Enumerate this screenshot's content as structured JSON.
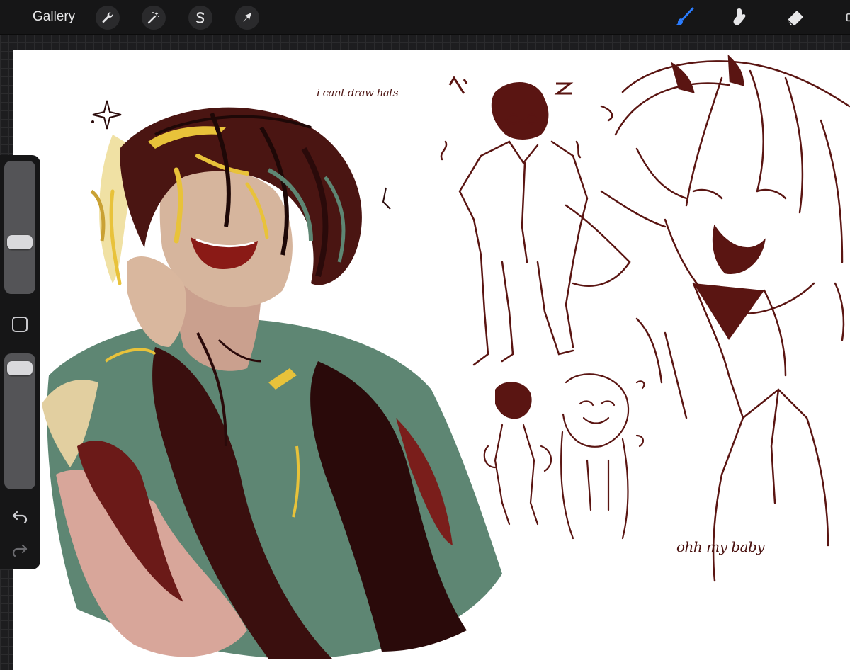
{
  "toolbar": {
    "gallery_label": "Gallery",
    "left_tools": [
      "wrench-icon",
      "magic-wand-icon",
      "selection-s-icon",
      "transform-arrow-icon"
    ],
    "right_tools": [
      "brush-icon",
      "smudge-icon",
      "eraser-icon"
    ],
    "active_tool": "brush-icon",
    "accent_color": "#2a7cff"
  },
  "canvas": {
    "annotations": {
      "hats_note": "i cant draw hats",
      "baby_note": "ohh my baby"
    },
    "ink_color": "#5a1512"
  },
  "sidebar": {
    "brush_size_level": 0.37,
    "opacity_level": 0.96,
    "tools": [
      "square-modify-icon",
      "undo-icon",
      "redo-icon"
    ]
  }
}
